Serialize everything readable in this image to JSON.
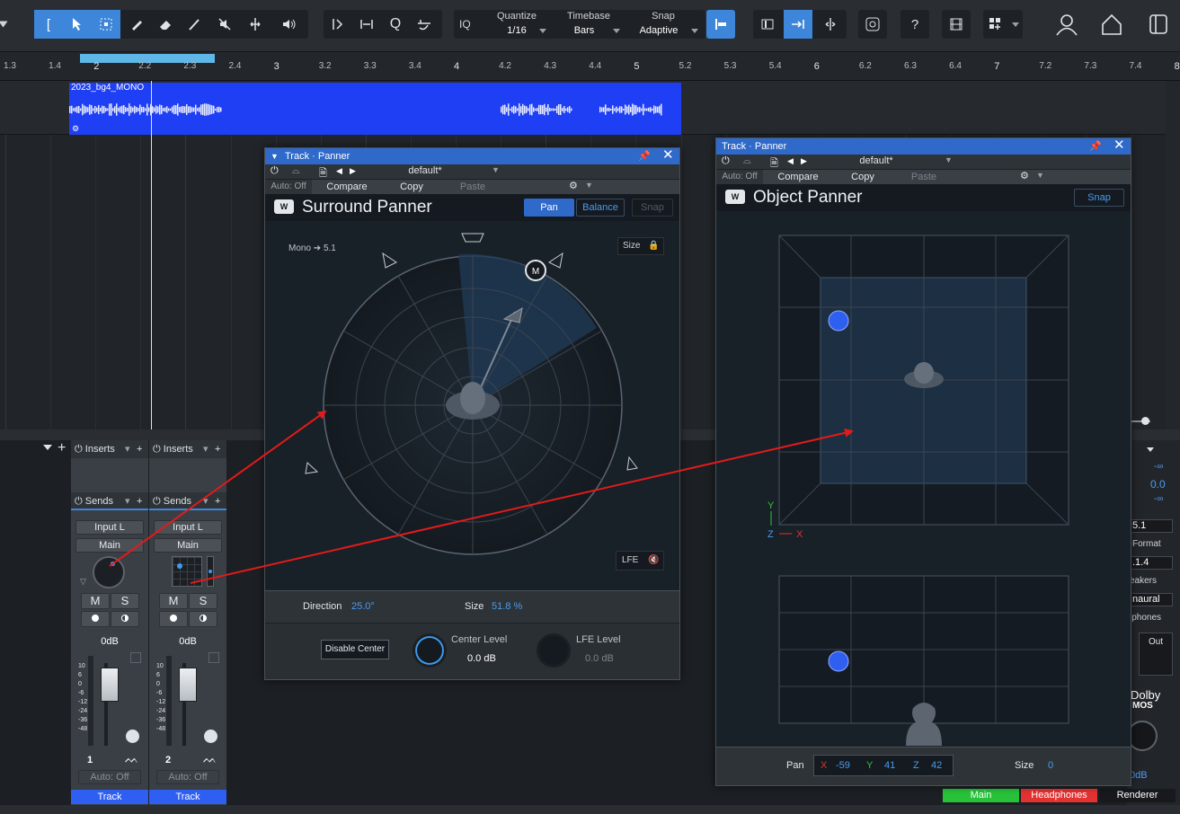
{
  "toolbar": {
    "quantize_label": "Quantize",
    "quantize_value": "1/16",
    "timebase_label": "Timebase",
    "timebase_value": "Bars",
    "snap_label": "Snap",
    "snap_value": "Adaptive",
    "iq_label": "IQ",
    "help_label": "?"
  },
  "ruler": {
    "labels": [
      "1.3",
      "1.4",
      "2",
      "2.2",
      "2.3",
      "2.4",
      "3",
      "3.2",
      "3.3",
      "3.4",
      "4",
      "4.2",
      "4.3",
      "4.4",
      "5",
      "5.2",
      "5.3",
      "5.4",
      "6",
      "6.2",
      "6.3",
      "6.4",
      "7",
      "7.2",
      "7.3",
      "7.4",
      "8"
    ]
  },
  "clip": {
    "name": "2023_bg4_MONO"
  },
  "mixer": {
    "inserts_label": "Inserts",
    "sends_label": "Sends",
    "strips": [
      {
        "input": "Input L",
        "output": "Main",
        "mute": "M",
        "solo": "S",
        "volume": "0dB",
        "number": "1",
        "auto": "Auto: Off",
        "name": "Track"
      },
      {
        "input": "Input L",
        "output": "Main",
        "mute": "M",
        "solo": "S",
        "volume": "0dB",
        "number": "2",
        "auto": "Auto: Off",
        "name": "Track"
      }
    ],
    "fader_scale": [
      "10",
      "6",
      "0",
      "-6",
      "-12",
      "-24",
      "-36",
      "-48"
    ]
  },
  "surround": {
    "window_title": "Track · Panner",
    "preset": "default*",
    "auto": "Auto: Off",
    "compare": "Compare",
    "copy": "Copy",
    "paste": "Paste",
    "title": "Surround Panner",
    "pan_tab": "Pan",
    "balance_tab": "Balance",
    "snap": "Snap",
    "mode": "Mono ➔ 5.1",
    "size_btn": "Size",
    "marker": "M",
    "lfe_btn": "LFE",
    "direction_label": "Direction",
    "direction_value": "25.0°",
    "size_label": "Size",
    "size_value": "51.8 %",
    "disable_center": "Disable Center",
    "center_label": "Center Level",
    "center_value": "0.0 dB",
    "lfe_label": "LFE Level",
    "lfe_value": "0.0 dB"
  },
  "object": {
    "window_title": "Track · Panner",
    "preset": "default*",
    "auto": "Auto: Off",
    "compare": "Compare",
    "copy": "Copy",
    "paste": "Paste",
    "title": "Object Panner",
    "snap": "Snap",
    "axis_y": "Y",
    "axis_z": "Z",
    "axis_x": "X",
    "pan_label": "Pan",
    "x_label": "X",
    "x_value": "-59",
    "y_label": "Y",
    "y_value": "41",
    "z_label": "Z",
    "z_value": "42",
    "size_label": "Size",
    "size_value": "0"
  },
  "right_panel": {
    "neg_inf_top": "-∞",
    "level": "0.0",
    "neg_inf_bottom": "-∞",
    "channel_format": "5.1",
    "format_label": "Format",
    "speaker_config": ".1.4",
    "speakers_label": "eakers",
    "binaural": "naural",
    "headphones_label": "lphones",
    "out_label": "Out",
    "dolby_line1": "Dolby",
    "dolby_line2": "MOS",
    "db_value": "0dB",
    "main_tab": "Main",
    "headphones_tab": "Headphones",
    "renderer_tab": "Renderer"
  },
  "colors": {
    "accent": "#3d86d9",
    "clip": "#1f3ff5",
    "annotation_arrow": "#e11b1b",
    "main_tab": "#27c23a",
    "headphones_tab": "#e23232"
  }
}
